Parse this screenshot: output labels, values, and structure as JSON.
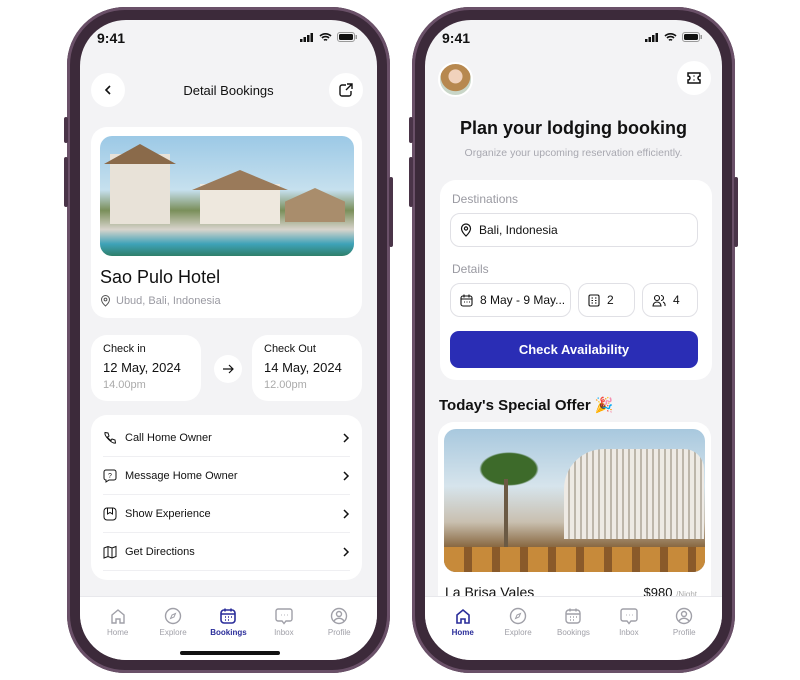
{
  "status": {
    "time": "9:41"
  },
  "left": {
    "header": {
      "title": "Detail Bookings",
      "back_icon": "chevron-left-icon",
      "share_icon": "share-icon"
    },
    "hotel": {
      "name": "Sao Pulo Hotel",
      "location": "Ubud, Bali, Indonesia"
    },
    "check_in": {
      "label": "Check in",
      "date": "12 May, 2024",
      "time": "14.00pm"
    },
    "check_out": {
      "label": "Check Out",
      "date": "14 May, 2024",
      "time": "12.00pm"
    },
    "actions": [
      {
        "label": "Call Home Owner",
        "icon": "phone-icon"
      },
      {
        "label": "Message Home Owner",
        "icon": "message-question-icon"
      },
      {
        "label": "Show Experience",
        "icon": "bookmark-icon"
      },
      {
        "label": "Get Directions",
        "icon": "map-icon"
      }
    ],
    "tabs": [
      {
        "label": "Home"
      },
      {
        "label": "Explore"
      },
      {
        "label": "Bookings"
      },
      {
        "label": "Inbox"
      },
      {
        "label": "Profile"
      }
    ],
    "active_tab": "Bookings"
  },
  "right": {
    "title": "Plan your lodging booking",
    "subtitle": "Organize your upcoming reservation efficiently.",
    "destinations_label": "Destinations",
    "destination_value": "Bali, Indonesia",
    "details_label": "Details",
    "dates_value": "8 May - 9 May...",
    "rooms_value": "2",
    "guests_value": "4",
    "button_label": "Check Availability",
    "offer_title": "Today's Special Offer 🎉",
    "offer": {
      "name": "La Brisa Vales",
      "price": "$980",
      "unit": "/Night"
    },
    "tabs": [
      {
        "label": "Home"
      },
      {
        "label": "Explore"
      },
      {
        "label": "Bookings"
      },
      {
        "label": "Inbox"
      },
      {
        "label": "Profile"
      }
    ],
    "active_tab": "Home"
  },
  "colors": {
    "accent": "#2a2db5",
    "tab_active": "#2a2d9a",
    "frame": "#3c2a3a"
  }
}
